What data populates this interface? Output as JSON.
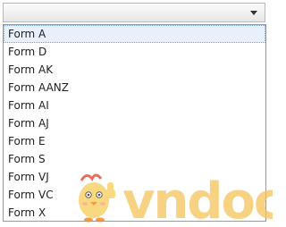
{
  "combo": {
    "value": ""
  },
  "dropdown": {
    "items": [
      "Form A",
      "Form D",
      "Form AK",
      "Form AANZ",
      "Form AI",
      "Form AJ",
      "Form E",
      "Form S",
      "Form VJ",
      "Form VC",
      "Form X"
    ],
    "highlighted_index": 0
  },
  "watermark": {
    "text": "vndoc",
    "color": "#f6c35a",
    "mascot": "chick-thumbs-up-icon"
  },
  "colors": {
    "highlight_bg": "#e8f1fb",
    "border": "#9a9a9a"
  }
}
